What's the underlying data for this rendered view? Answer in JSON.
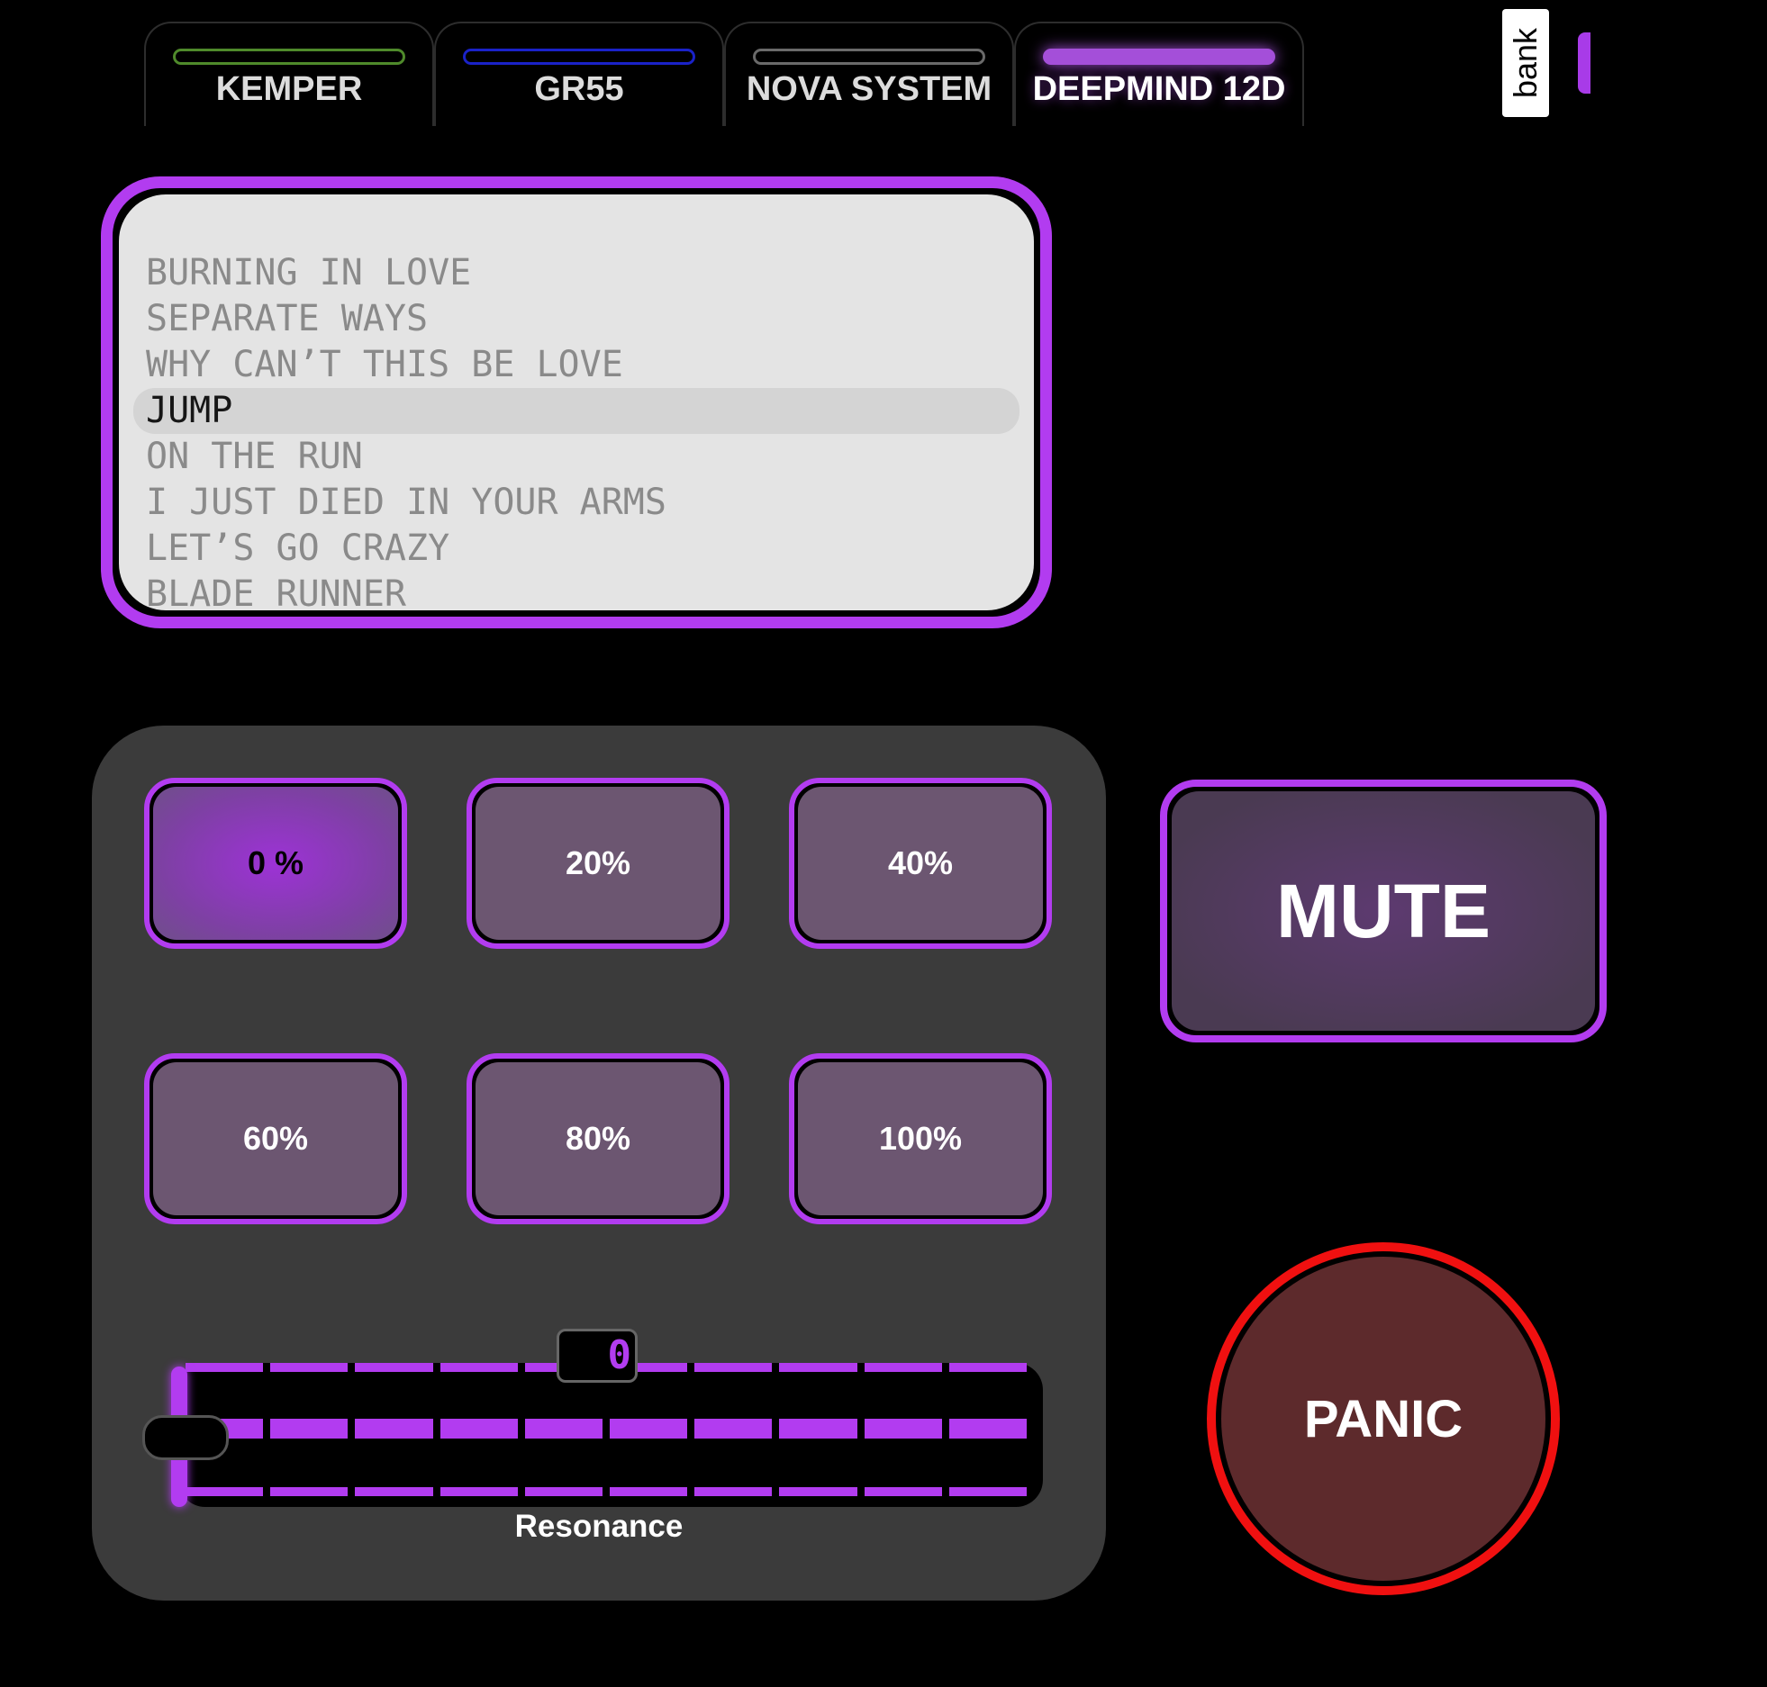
{
  "tabs": [
    {
      "label": "KEMPER",
      "indicator_color": "#4f8a2b",
      "active": false
    },
    {
      "label": "GR55",
      "indicator_color": "#1a22c8",
      "active": false
    },
    {
      "label": "NOVA SYSTEM",
      "indicator_color": "#6a6a6a",
      "active": false
    },
    {
      "label": "DEEPMIND 12D",
      "indicator_color": "#a44fd9",
      "active": true
    }
  ],
  "bank_label": "bank",
  "song_list": {
    "items": [
      "BURNING IN LOVE",
      "SEPARATE WAYS",
      "WHY CAN’T THIS BE LOVE",
      "JUMP",
      "ON THE RUN",
      "I JUST DIED IN YOUR ARMS",
      "LET’S GO CRAZY",
      "BLADE RUNNER"
    ],
    "selected": "JUMP"
  },
  "pads": [
    "0 %",
    "20%",
    "40%",
    "60%",
    "80%",
    "100%"
  ],
  "active_pad": "0 %",
  "slider": {
    "label": "Resonance",
    "value": "0",
    "value_fraction": 0
  },
  "mute_label": "MUTE",
  "panic_label": "PANIC",
  "colors": {
    "accent": "#b23cf0",
    "panic_ring": "#f01010",
    "panel": "#3b3b3b",
    "background": "#000000"
  }
}
